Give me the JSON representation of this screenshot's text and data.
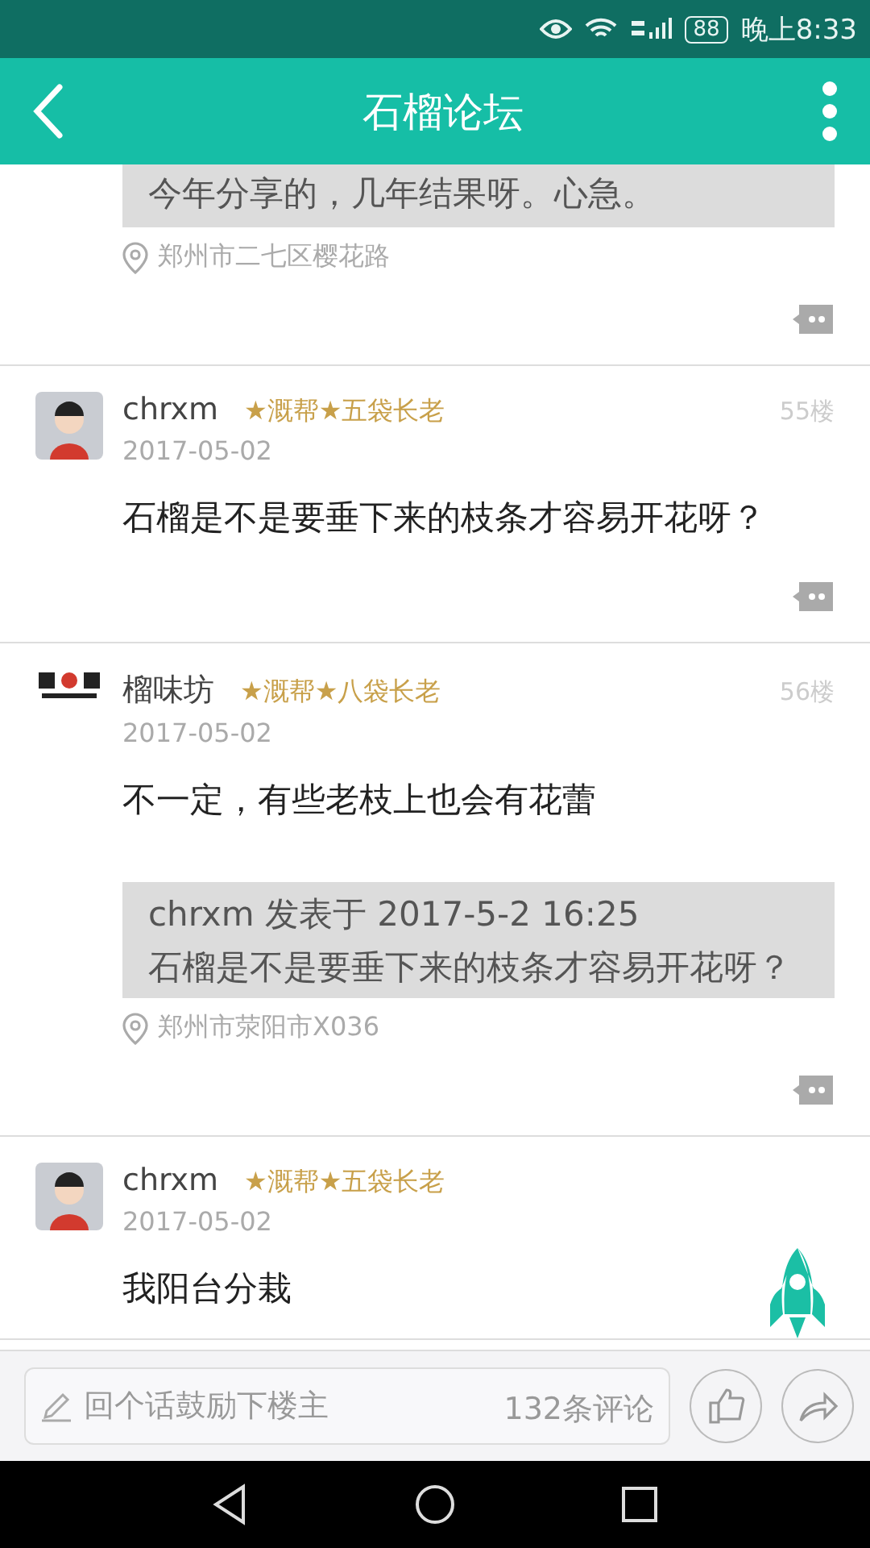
{
  "status_bar": {
    "battery": "88",
    "time": "晚上8:33"
  },
  "header": {
    "title": "石榴论坛"
  },
  "posts": [
    {
      "quote": {
        "text": "今年分享的，几年结果呀。心急。"
      },
      "location": "郑州市二七区樱花路",
      "comment_icon": true
    },
    {
      "avatar": {
        "kind": "person"
      },
      "author": "chrxm",
      "badge": "★溉帮★五袋长老",
      "date": "2017-05-02",
      "floor": "55楼",
      "content": "石榴是不是要垂下来的枝条才容易开花呀？",
      "comment_icon": true
    },
    {
      "avatar": {
        "kind": "logo"
      },
      "author": "榴味坊",
      "badge": "★溉帮★八袋长老",
      "date": "2017-05-02",
      "floor": "56楼",
      "content": "不一定，有些老枝上也会有花蕾",
      "quote": {
        "header": "chrxm 发表于 2017-5-2 16:25",
        "text": "石榴是不是要垂下来的枝条才容易开花呀？"
      },
      "location": "郑州市荥阳市X036",
      "comment_icon": true
    },
    {
      "avatar": {
        "kind": "person"
      },
      "author": "chrxm",
      "badge": "★溉帮★五袋长老",
      "date": "2017-05-02",
      "content": "我阳台分栽",
      "comment_icon": false
    }
  ],
  "reply_bar": {
    "placeholder": "回个话鼓励下楼主",
    "count": "132条评论"
  }
}
